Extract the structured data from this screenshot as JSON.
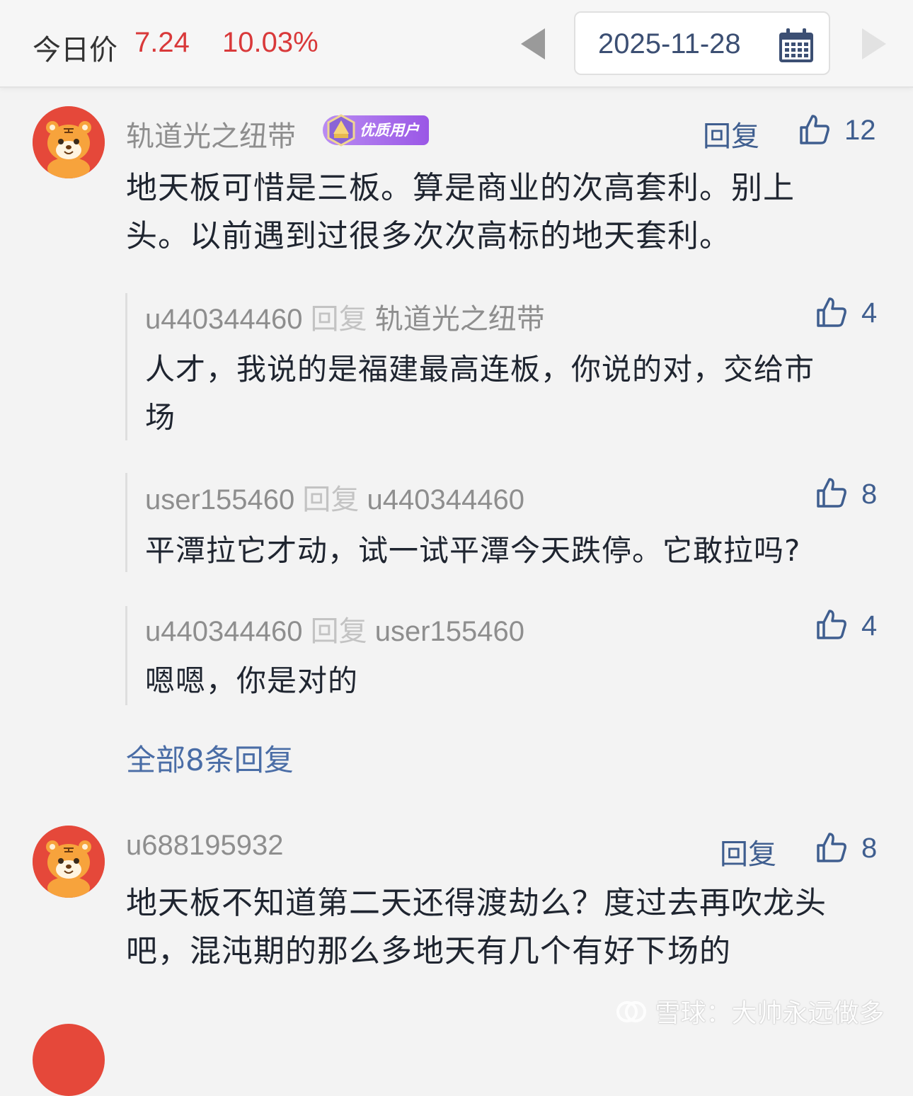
{
  "header": {
    "price_label": "今日价",
    "price": "7.24",
    "change": "10.03%",
    "date": "2025-11-28",
    "colors": {
      "up": "#d9393a",
      "date_text": "#3c4f73"
    }
  },
  "comments": [
    {
      "user": "轨道光之纽带",
      "badge": "优质用户",
      "reply_label": "回复",
      "likes": "12",
      "text_lines": [
        "地天板可惜是三板。算是商业的次高套利。别上",
        "头。以前遇到过很多次次高标的地天套利。"
      ],
      "replies": [
        {
          "user": "u440344460",
          "reply_word": "回复",
          "target": "轨道光之纽带",
          "likes": "4",
          "text_lines": [
            "人才，我说的是福建最高连板，你说的对，交给市",
            "场"
          ]
        },
        {
          "user": "user155460",
          "reply_word": "回复",
          "target": "u440344460",
          "likes": "8",
          "text_lines": [
            "平潭拉它才动，试一试平潭今天跌停。它敢拉吗?"
          ]
        },
        {
          "user": "u440344460",
          "reply_word": "回复",
          "target": "user155460",
          "likes": "4",
          "text_lines": [
            "嗯嗯，你是对的"
          ]
        }
      ],
      "all_replies_label": "全部8条回复"
    },
    {
      "user": "u688195932",
      "reply_label": "回复",
      "likes": "8",
      "text_lines": [
        "地天板不知道第二天还得渡劫么？度过去再吹龙头",
        "吧，混沌期的那么多地天有几个有好下场的"
      ]
    }
  ],
  "watermark": "雪球：大帅永远做多",
  "icons": {
    "prev": "triangle-left-icon",
    "next": "triangle-right-icon",
    "calendar": "calendar-icon",
    "like": "thumbs-up-icon",
    "avatar": "tiger-avatar-icon",
    "badge": "gem-badge-icon",
    "watermark_logo": "snowball-logo-icon"
  }
}
